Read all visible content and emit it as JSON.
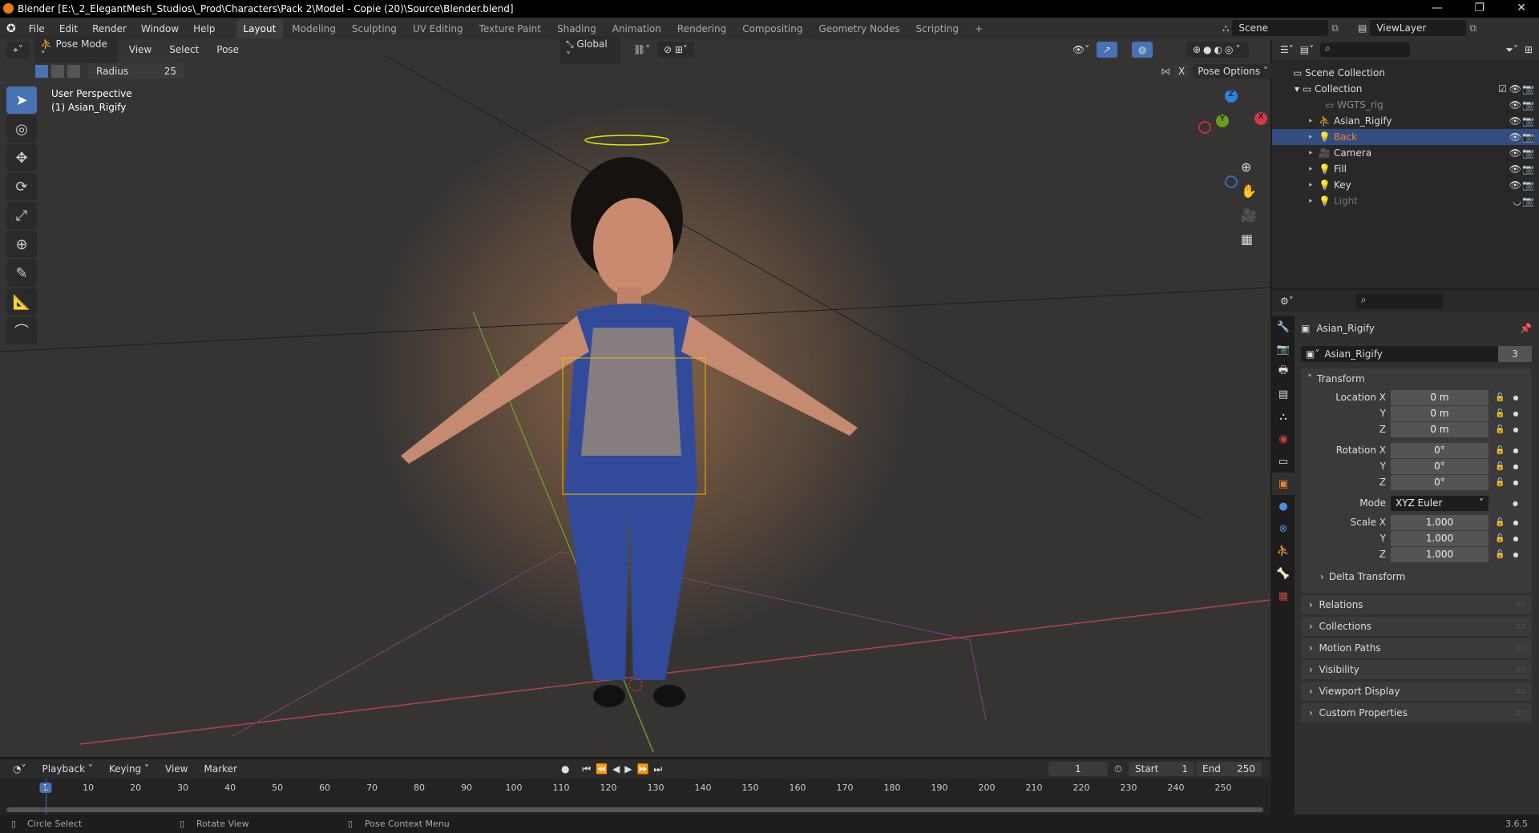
{
  "title": "Blender [E:\\_2_ElegantMesh_Studios\\_Prod\\Characters\\Pack 2\\Model - Copie (20)\\Source\\Blender.blend]",
  "menu": [
    "File",
    "Edit",
    "Render",
    "Window",
    "Help"
  ],
  "workspaces": [
    "Layout",
    "Modeling",
    "Sculpting",
    "UV Editing",
    "Texture Paint",
    "Shading",
    "Animation",
    "Rendering",
    "Compositing",
    "Geometry Nodes",
    "Scripting",
    "+"
  ],
  "scene": "Scene",
  "view_layer": "ViewLayer",
  "viewport": {
    "mode": "Pose Mode",
    "menus": [
      "View",
      "Select",
      "Pose"
    ],
    "orientation": "Global",
    "radius_label": "Radius",
    "radius_value": "25",
    "pose_options": "Pose Options",
    "x_label": "X",
    "perspective": "User Perspective",
    "object": "(1) Asian_Rigify",
    "gizmo": {
      "x": "X",
      "y": "Y",
      "z": "Z"
    }
  },
  "outliner": {
    "root": "Scene Collection",
    "collection": "Collection",
    "items": [
      {
        "name": "WGTS_rig",
        "color": "#888888"
      },
      {
        "name": "Asian_Rigify",
        "color": "#dddddd"
      },
      {
        "name": "Back",
        "color": "#e8832a"
      },
      {
        "name": "Camera",
        "color": "#dddddd"
      },
      {
        "name": "Fill",
        "color": "#dddddd"
      },
      {
        "name": "Key",
        "color": "#dddddd"
      },
      {
        "name": "Light",
        "color": "#777777"
      }
    ]
  },
  "properties": {
    "object_name": "Asian_Rigify",
    "data_name": "Asian_Rigify",
    "users": "3",
    "transform": "Transform",
    "location": {
      "label": "Location X",
      "x": "0 m",
      "y": "0 m",
      "z": "0 m"
    },
    "rotation": {
      "label": "Rotation X",
      "x": "0°",
      "y": "0°",
      "z": "0°"
    },
    "mode_label": "Mode",
    "mode": "XYZ Euler",
    "scale": {
      "label": "Scale X",
      "x": "1.000",
      "y": "1.000",
      "z": "1.000"
    },
    "axis_y": "Y",
    "axis_z": "Z",
    "delta": "Delta Transform",
    "panels": [
      "Relations",
      "Collections",
      "Motion Paths",
      "Visibility",
      "Viewport Display",
      "Custom Properties"
    ]
  },
  "timeline": {
    "menus": [
      "Playback",
      "Keying",
      "View",
      "Marker"
    ],
    "current_frame": "1",
    "start_label": "Start",
    "start": "1",
    "end_label": "End",
    "end": "250",
    "ticks": [
      "1",
      "10",
      "20",
      "30",
      "40",
      "50",
      "60",
      "70",
      "80",
      "90",
      "100",
      "110",
      "120",
      "130",
      "140",
      "150",
      "160",
      "170",
      "180",
      "190",
      "200",
      "210",
      "220",
      "230",
      "240",
      "250"
    ]
  },
  "status": {
    "left": "Circle Select",
    "middle": "Rotate View",
    "right": "Pose Context Menu",
    "version": "3.6.5"
  }
}
